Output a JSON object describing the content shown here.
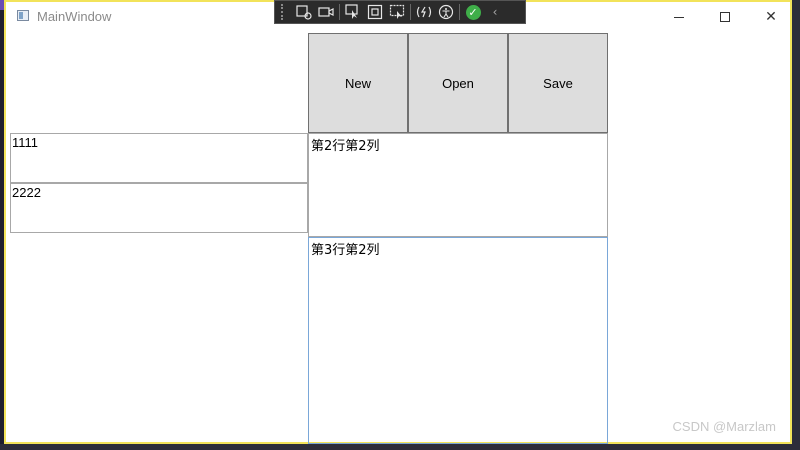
{
  "window": {
    "title": "MainWindow",
    "border_color": "#f2e35a"
  },
  "debug_toolbar": {
    "icons": [
      "select-element-icon",
      "record-icon",
      "select-target-icon",
      "display-layout-icon",
      "track-focus-icon",
      "hot-reload-icon",
      "accessibility-icon",
      "status-ok-icon",
      "collapse-icon"
    ]
  },
  "toolbar": {
    "new_label": "New",
    "open_label": "Open",
    "save_label": "Save"
  },
  "left_panel": {
    "textbox1": "1111",
    "textbox2": "2222"
  },
  "grid": {
    "row2_col2": "第2行第2列",
    "row3_col2": "第3行第2列"
  },
  "watermark": "CSDN @Marzlam"
}
